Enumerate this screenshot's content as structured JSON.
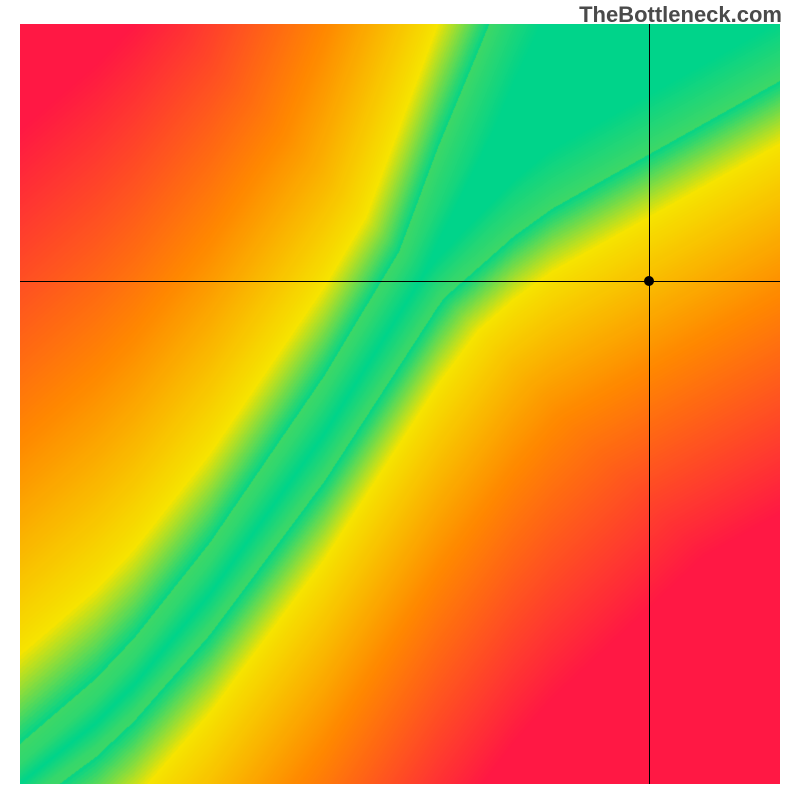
{
  "watermark": "TheBottleneck.com",
  "chart_data": {
    "type": "heatmap",
    "title": "",
    "xlabel": "",
    "ylabel": "",
    "xlim": [
      0,
      1
    ],
    "ylim": [
      0,
      1
    ],
    "optimal_curve_points": [
      {
        "x": 0.0,
        "y": 0.0
      },
      {
        "x": 0.05,
        "y": 0.04
      },
      {
        "x": 0.1,
        "y": 0.08
      },
      {
        "x": 0.15,
        "y": 0.13
      },
      {
        "x": 0.2,
        "y": 0.19
      },
      {
        "x": 0.25,
        "y": 0.25
      },
      {
        "x": 0.3,
        "y": 0.32
      },
      {
        "x": 0.35,
        "y": 0.39
      },
      {
        "x": 0.4,
        "y": 0.46
      },
      {
        "x": 0.45,
        "y": 0.54
      },
      {
        "x": 0.5,
        "y": 0.62
      },
      {
        "x": 0.55,
        "y": 0.7
      },
      {
        "x": 0.6,
        "y": 0.77
      },
      {
        "x": 0.65,
        "y": 0.84
      },
      {
        "x": 0.7,
        "y": 0.9
      },
      {
        "x": 0.75,
        "y": 0.95
      },
      {
        "x": 0.8,
        "y": 1.0
      }
    ],
    "band_half_width_base": 0.025,
    "band_half_width_growth": 0.06,
    "marker": {
      "x": 0.827,
      "y": 0.662
    },
    "crosshair": {
      "vertical_x": 0.827,
      "horizontal_y": 0.662
    },
    "colors": {
      "best": "#00d48a",
      "yellow": "#f6e400",
      "orange": "#ff8a00",
      "worst": "#ff1844"
    },
    "grid": false,
    "legend": null
  }
}
